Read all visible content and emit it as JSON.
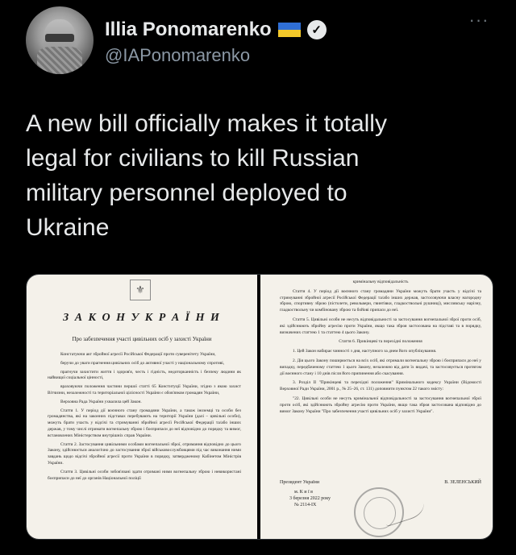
{
  "author": {
    "display_name": "Illia Ponomarenko",
    "handle": "@IAPonomarenko",
    "flag": "ukraine-flag-icon",
    "verified": "verified-badge-icon"
  },
  "more_label": "···",
  "tweet_text": "A new bill officially makes it totally\nlegal for civilians to kill Russian\nmilitary personnel deployed to\nUkraine",
  "document": {
    "left": {
      "title": "З А К О Н   У К Р А Ї Н И",
      "subtitle": "Про забезпечення участі цивільних осіб у захисті України",
      "paragraphs": [
        "Констатуючи акт збройної агресії Російської Федерації проти суверенітету України,",
        "беручи до уваги прагнення цивільних осіб до активної участі у національному спротиві,",
        "прагнучи захистити життя і здоров'я, честь і гідність, недоторканність і безпеку людини як найвищої соціальної цінності,",
        "враховуючи положення частини першої статті 65 Конституції України, згідно з якою захист Вітчизни, незалежності та територіальної цілісності України є обов'язком громадян України,",
        "Верховна Рада України ухвалила цей Закон.",
        "Стаття 1. У період дії воєнного стану громадяни України, а також іноземці та особи без громадянства, які на законних підставах перебувають на території України (далі – цивільні особи), можуть брати участь у відсічі та стримуванні збройної агресії Російської Федерації та/або інших держав, у тому числі отримати вогнепальну зброю і боєприпаси до неї відповідно до порядку та вимог, встановлених Міністерством внутрішніх справ України.",
        "Стаття 2. Застосування цивільними особами вогнепальної зброї, отримання відповідно до цього Закону, здійснюється аналогічно до застосування зброї військовослужбовцями під час виконання ними завдань щодо відсічі збройної агресії проти України в порядку, затвердженому Кабінетом Міністрів України.",
        "Стаття 3. Цивільні особи зобов'язані здати отримані ними вогнепальну зброю і невикористані боєприпаси до неї до органів Національної поліції"
      ]
    },
    "right": {
      "header_fragment": "кримінальну відповідальність",
      "paragraphs": [
        "Стаття 4. У період дії воєнного стану громадяни України можуть брати участь у відсічі та стримуванні збройної агресії Російської Федерації та/або інших держав, застосовуючи власну нагородну зброю, спортивну зброю (пістолети, револьвери, гвинтівки, гладкоствольні рушниці), мисливську нарізну, гладкоствольну чи комбіновану зброю та бойові припаси до неї.",
        "Стаття 5. Цивільні особи не несуть відповідальності за застосування вогнепальної зброї проти осіб, які здійснюють збройну агресію проти України, якщо така зброя застосована на підставі та в порядку, визначених статтею 1 та статтею 4 цього Закону.",
        "Стаття 6. Прикінцеві та перехідні положення",
        "1. Цей Закон набирає чинності з дня, наступного за днем його опублікування.",
        "2. Дія цього Закону поширюється на всіх осіб, які отримали вогнепальну зброю і боєприпаси до неї у випадку, передбаченому статтею 1 цього Закону, незалежно від дати їх видачі, та застосовується протягом дії воєнного стану і 10 днів після його припинення або скасування.",
        "3. Розділ II \"Прикінцеві та перехідні положення\" Кримінального кодексу України (Відомості Верховної Ради України, 2001 р., № 25–26, ст. 131) доповнити пунктом 22 такого змісту:",
        "\"22. Цивільні особи не несуть кримінальної відповідальності за застосування вогнепальної зброї проти осіб, які здійснюють збройну агресію проти України, якщо така зброя застосована відповідно до вимог Закону України \"Про забезпечення участі цивільних осіб у захисті України\"."
      ],
      "signature": {
        "president": "Президент України",
        "name": "В. ЗЕЛЕНСЬКИЙ",
        "place": "м. К и ї в",
        "date": "3 березня 2022 року",
        "number": "№ 2114-IX"
      }
    }
  }
}
